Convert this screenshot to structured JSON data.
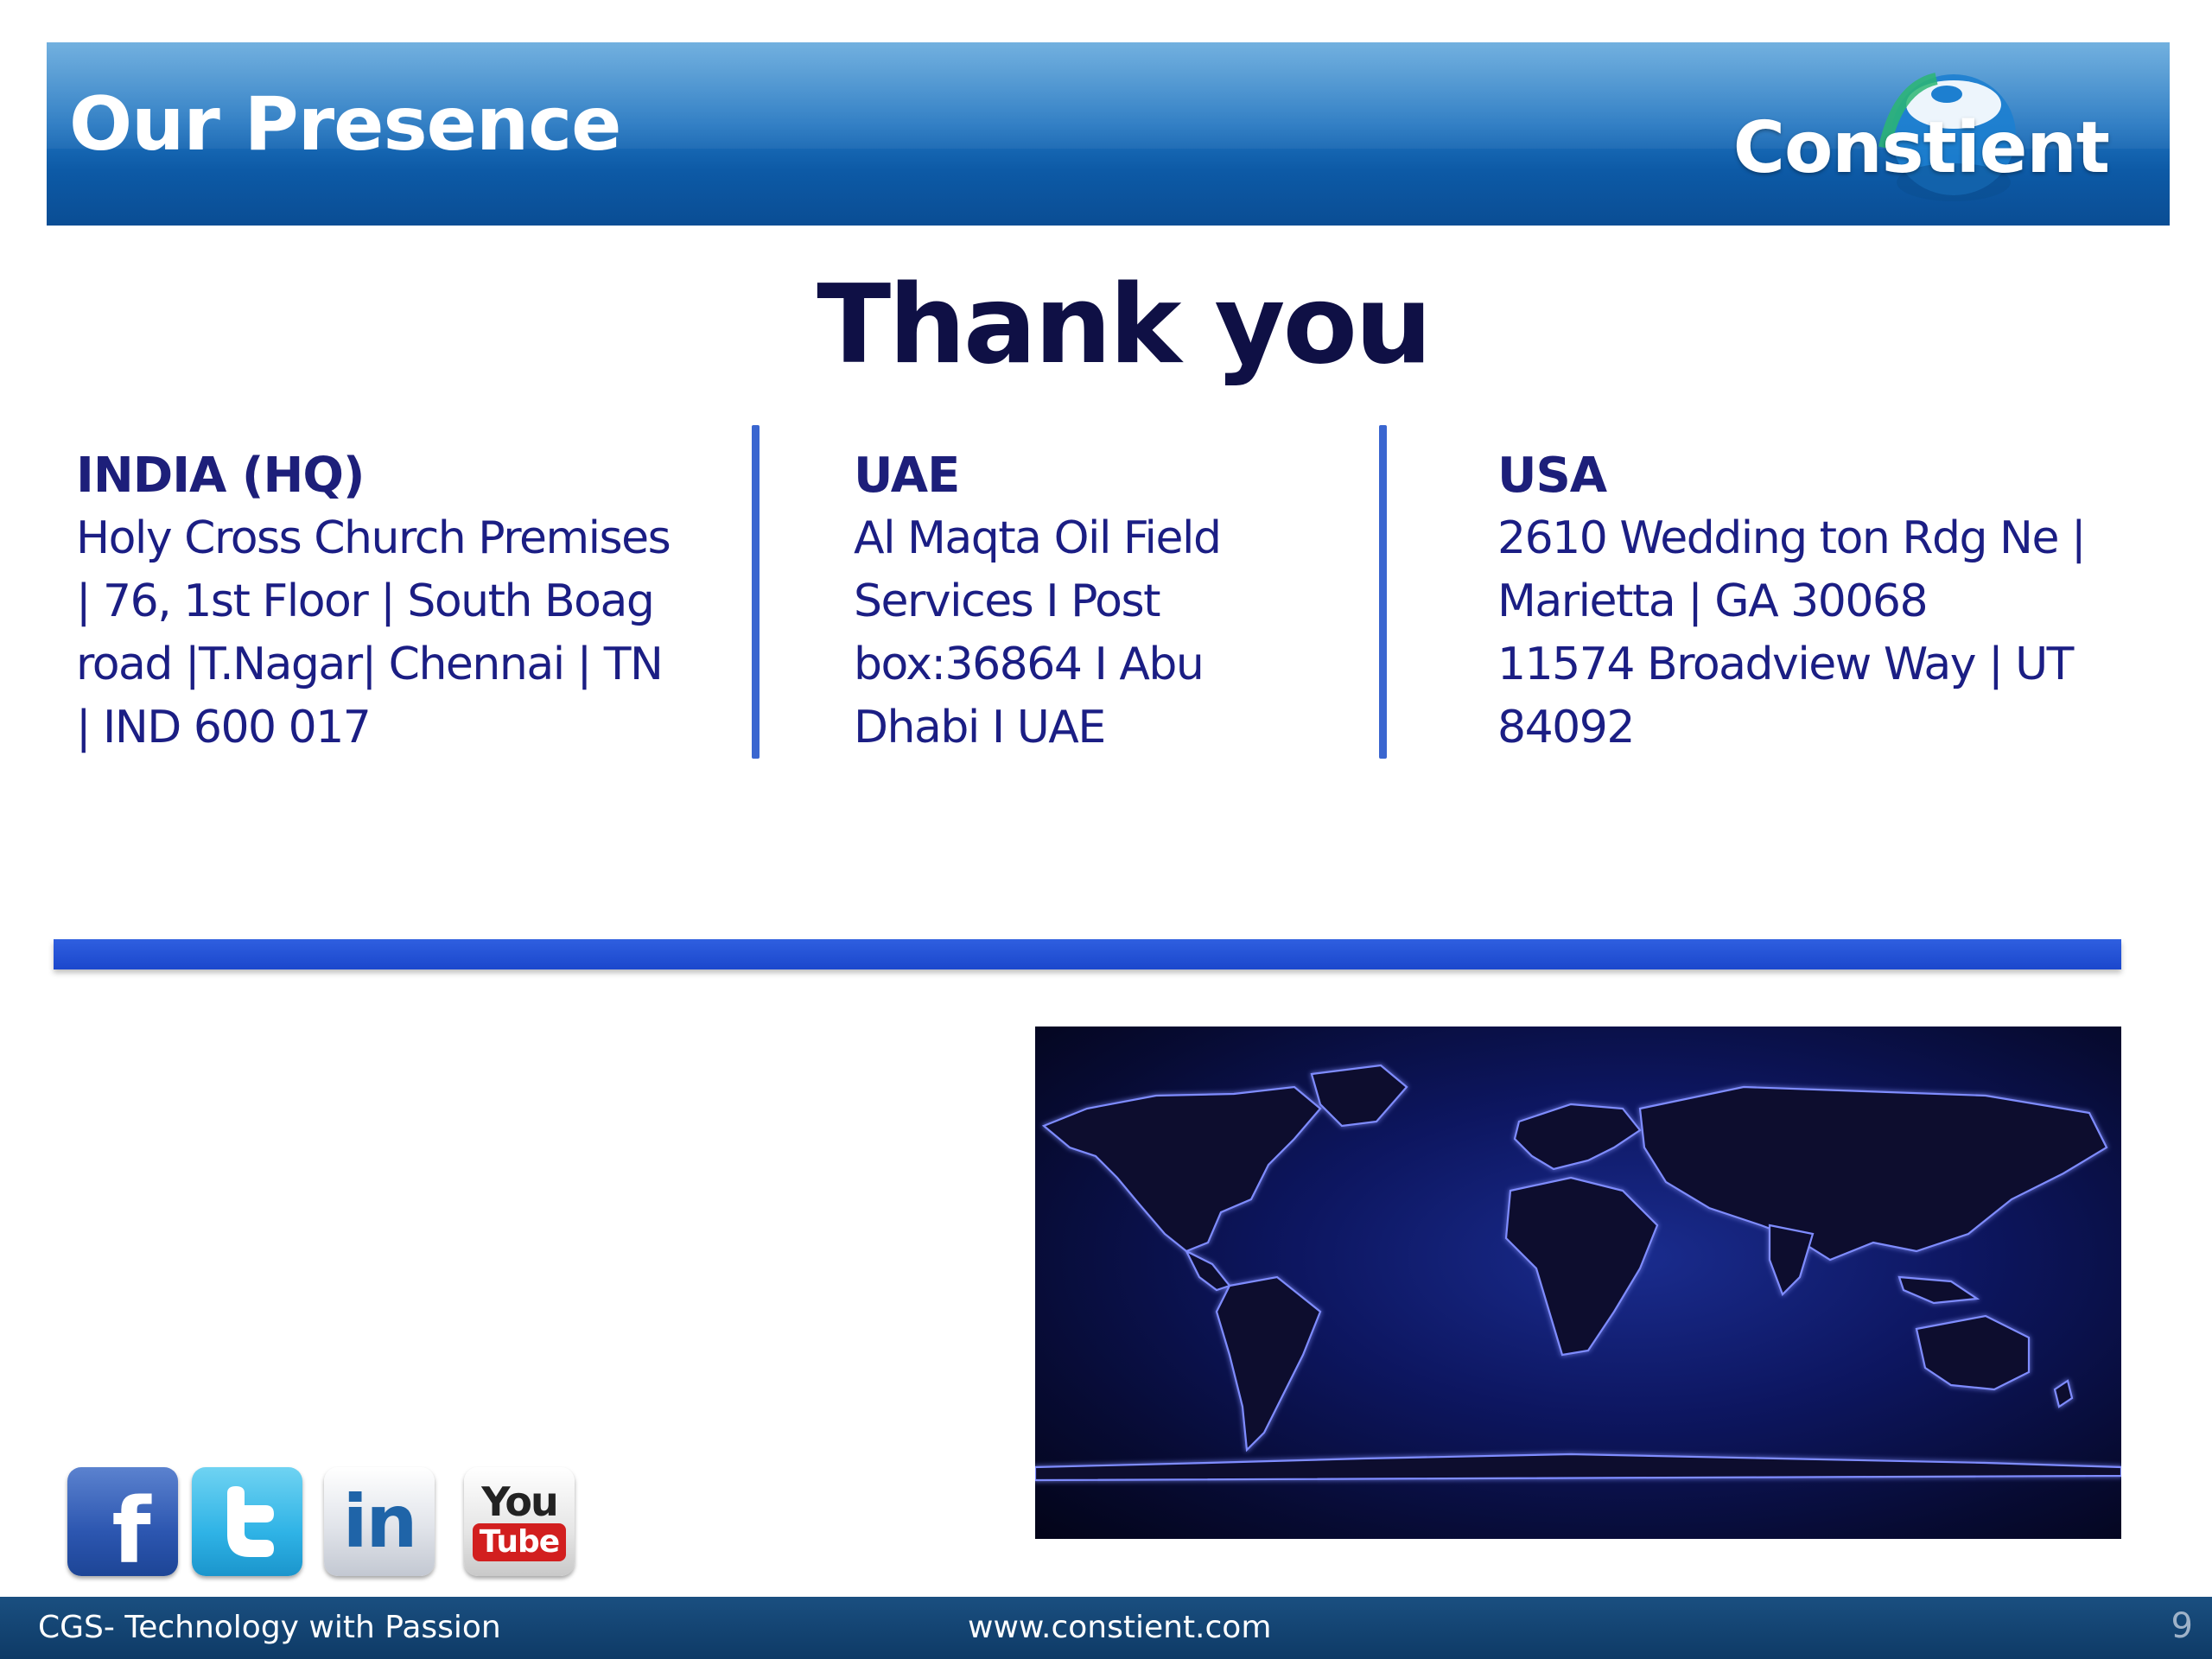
{
  "header": {
    "title": "Our Presence",
    "logo_text": "Constient"
  },
  "headline": "Thank you",
  "offices": [
    {
      "name": "INDIA (HQ)",
      "lines": [
        "Holy Cross Church Premises",
        "| 76, 1st Floor | South Boag",
        "road |T.Nagar|  Chennai | TN",
        "| IND 600 017"
      ]
    },
    {
      "name": "UAE",
      "lines": [
        "Al Maqta Oil Field",
        "Services I Post",
        "box:36864 I Abu",
        "Dhabi I UAE"
      ]
    },
    {
      "name": "USA",
      "lines": [
        "2610 Wedding ton Rdg Ne |",
        "Marietta | GA 30068",
        "11574 Broadview Way | UT",
        "84092"
      ]
    }
  ],
  "social": {
    "facebook_glyph": "f",
    "linkedin_glyph": "in",
    "youtube_top": "You",
    "youtube_bottom": "Tube",
    "icons": [
      "facebook-icon",
      "twitter-icon",
      "linkedin-icon",
      "youtube-icon"
    ]
  },
  "footer": {
    "tagline": "CGS- Technology with Passion",
    "website": "www.constient.com",
    "page_number": "9"
  },
  "colors": {
    "banner_blue": "#1f73bf",
    "heading_navy": "#0f1045",
    "address_blue": "#1b1e84",
    "divider_blue": "#2f5fe0",
    "footer_navy": "#0e3a66"
  }
}
